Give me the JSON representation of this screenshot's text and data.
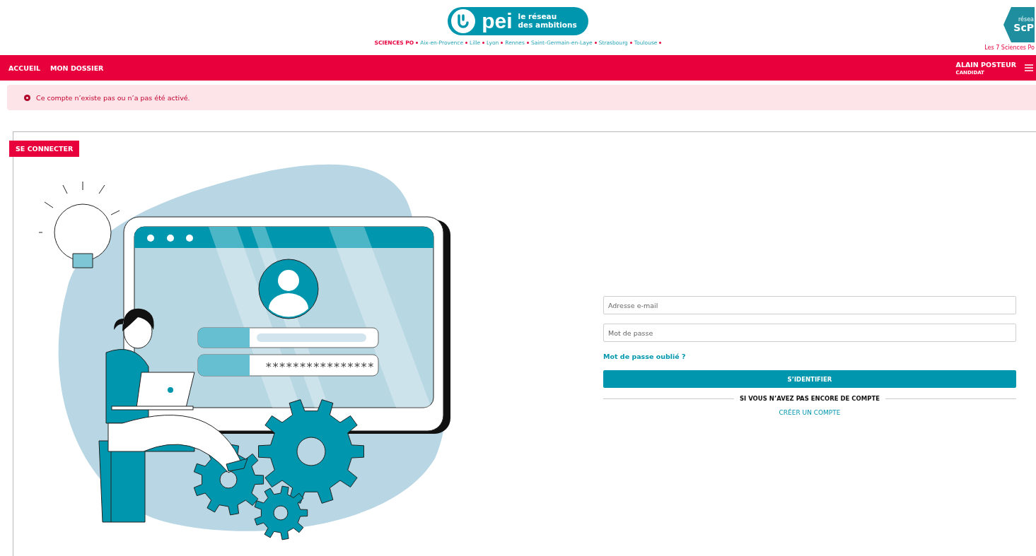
{
  "header": {
    "logo": {
      "mark": "pei",
      "tagline": [
        "le réseau",
        "des ambitions"
      ]
    },
    "institution": "SCIENCES PO",
    "campuses": [
      "Aix-en-Provence",
      "Lille",
      "Lyon",
      "Rennes",
      "Saint-Germain-en-Laye",
      "Strasbourg",
      "Toulouse"
    ],
    "partner_logo": {
      "lines": [
        "résea",
        "ScP"
      ],
      "caption": "Les 7 Sciences Po"
    }
  },
  "nav": {
    "links": [
      {
        "label": "ACCUEIL"
      },
      {
        "label": "MON DOSSIER"
      }
    ],
    "user": {
      "name": "ALAIN POSTEUR",
      "role": "CANDIDAT"
    }
  },
  "alert": {
    "message": "Ce compte n’existe pas ou n’a pas été activé."
  },
  "login": {
    "tag": "SE CONNECTER",
    "illustration": {
      "password_mask": "****************"
    },
    "email": {
      "placeholder": "Adresse e-mail"
    },
    "password": {
      "placeholder": "Mot de passe"
    },
    "forgot_link": "Mot de passe oublié ?",
    "submit": "S’IDENTIFIER",
    "divider": "SI VOUS N’AVEZ PAS ENCORE DE COMPTE",
    "create_link": "CRÉER UN COMPTE"
  }
}
